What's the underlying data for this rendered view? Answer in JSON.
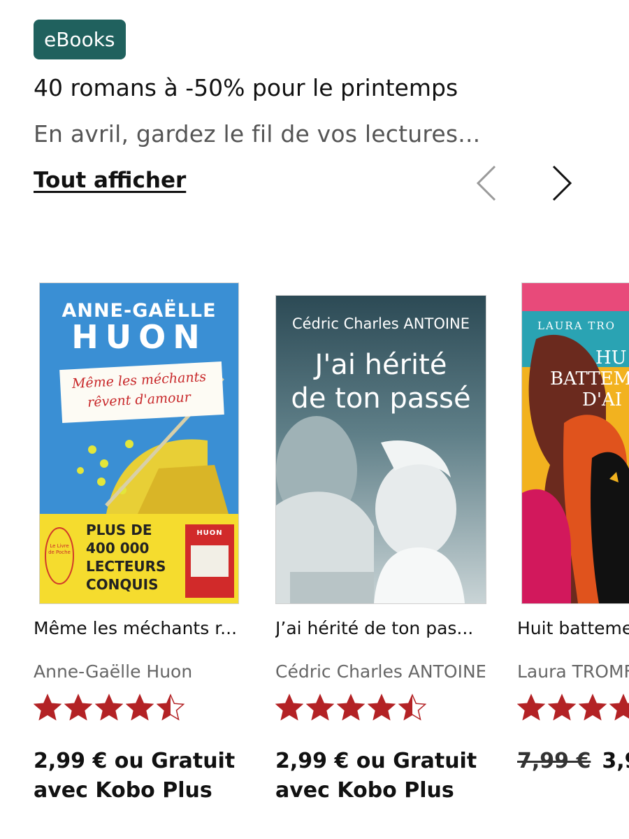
{
  "header": {
    "badge": "eBooks",
    "title": "40 romans à -50% pour le printemps",
    "subtitle": "En avril, gardez le fil de vos lectures...",
    "see_all": "Tout afficher"
  },
  "icons": {
    "prev": "chevron-left-icon",
    "next": "chevron-right-icon",
    "star": "star-icon"
  },
  "colors": {
    "badge_bg": "#20615e",
    "star": "#b32225",
    "muted": "#666666"
  },
  "books": [
    {
      "title": "Même les méchants r...",
      "author": "Anne-Gaëlle Huon",
      "rating": 4.5,
      "price": "2,99 € ou Gratuit avec Kobo Plus",
      "cover": {
        "author_line1": "ANNE-GAËLLE",
        "author_line2": "HUON",
        "title_line1": "Même les méchants",
        "title_line2": "rêvent d'amour",
        "blurb_line1": "PLUS DE",
        "blurb_line2": "400 000",
        "blurb_line3": "LECTEURS",
        "blurb_line4": "CONQUIS",
        "publisher": "Le Livre de Poche",
        "mini_author": "HUON"
      }
    },
    {
      "title": "J’ai hérité de ton pas...",
      "author": "Cédric Charles ANTOINE",
      "rating": 4.5,
      "price": "2,99 € ou Gratuit avec Kobo Plus",
      "cover": {
        "author": "Cédric Charles ANTOINE",
        "title_line1": "J'ai hérité",
        "title_line2": "de ton passé"
      }
    },
    {
      "title": "Huit batteme",
      "author": "Laura TROMF",
      "rating": 4.5,
      "price_old": "7,99 €",
      "price": "3,9",
      "cover": {
        "author": "LAURA TRO",
        "title_line1": "HU",
        "title_line2": "BATTEM",
        "title_line3": "D'AI"
      }
    }
  ]
}
